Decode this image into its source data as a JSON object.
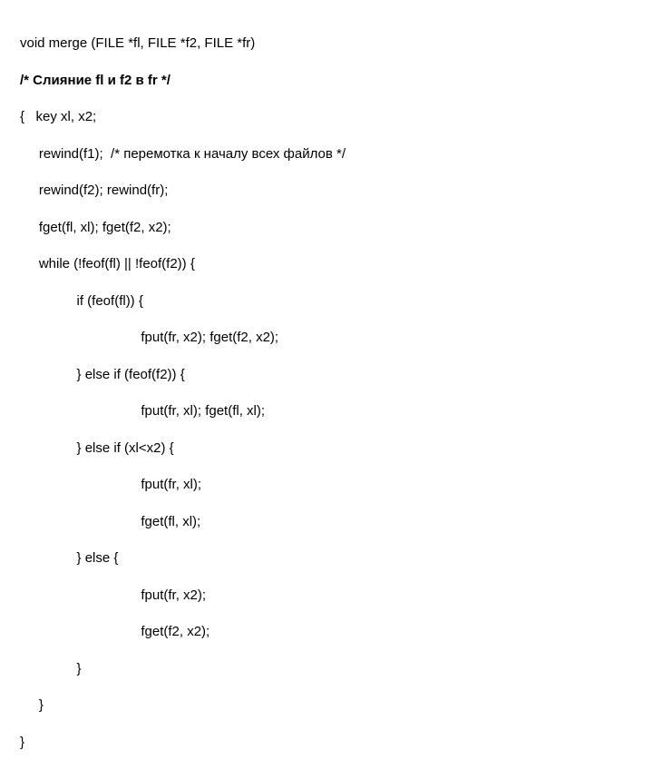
{
  "code": {
    "lines": [
      "void merge (FILE *fl, FILE *f2, FILE *fr)",
      "/* Слияние fl и f2 в fr */",
      "{   key xl, x2;",
      "     rewind(f1);  /* перемотка к началу всех файлов */",
      "     rewind(f2); rewind(fr);",
      "     fget(fl, xl); fget(f2, x2);",
      "     while (!feof(fl) || !feof(f2)) {",
      "               if (feof(fl)) {",
      "                                fput(fr, x2); fget(f2, x2);",
      "               } else if (feof(f2)) {",
      "                                fput(fr, xl); fget(fl, xl);",
      "               } else if (xl<x2) {",
      "                                fput(fr, xl);",
      "                                fget(fl, xl);",
      "               } else {",
      "                                fput(fr, x2);",
      "                                fget(f2, x2);",
      "               }",
      "     }",
      "}"
    ]
  }
}
